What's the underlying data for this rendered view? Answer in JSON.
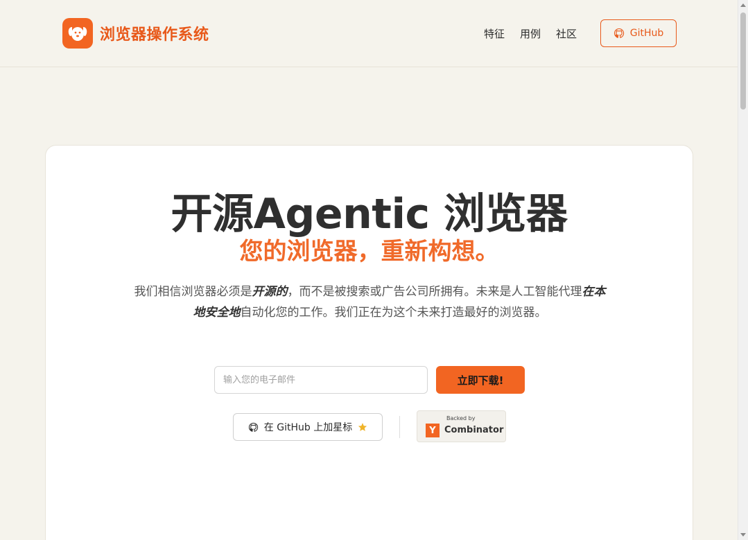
{
  "brand": {
    "name": "浏览器操作系统",
    "logo_icon": "dog-icon",
    "color": "#f26522"
  },
  "nav": {
    "items": [
      "特征",
      "用例",
      "社区"
    ],
    "github_label": "GitHub"
  },
  "hero": {
    "title": "开源Agentic 浏览器",
    "subtitle": "您的浏览器，重新构想。",
    "desc_part1": "我们相信浏览器必须是",
    "desc_em1": "开源的",
    "desc_part2": "，而不是被搜索或广告公司所拥有。未来是人工智能代理",
    "desc_em2": "在本地安全地",
    "desc_part3": "自动化您的工作。我们正在为这个未来打造最好的浏览器。"
  },
  "signup": {
    "placeholder": "输入您的电子邮件",
    "button_label": "立即下载!"
  },
  "star": {
    "label": "在 GitHub 上加星标"
  },
  "yc": {
    "top": "Backed by",
    "letter": "Y",
    "name": "Combinator"
  }
}
